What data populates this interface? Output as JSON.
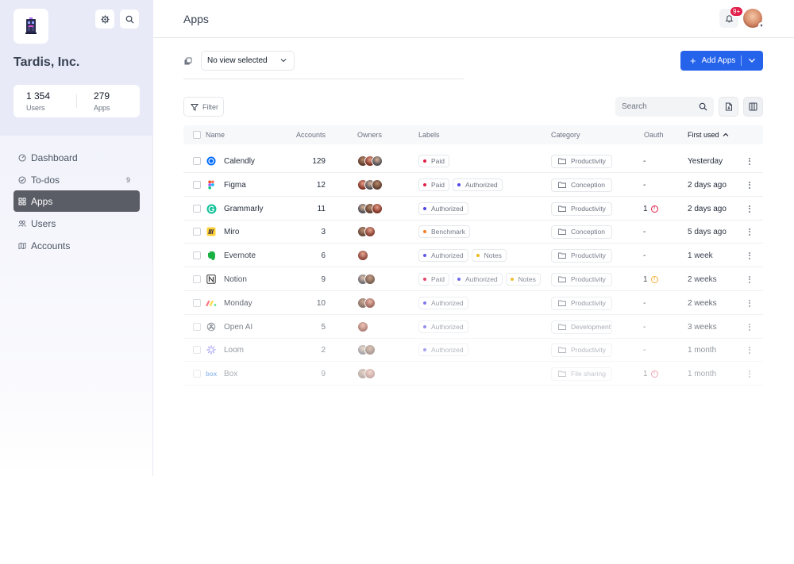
{
  "org": {
    "name": "Tardis, Inc.",
    "users_count": "1 354",
    "users_label": "Users",
    "apps_count": "279",
    "apps_label": "Apps"
  },
  "nav": [
    {
      "label": "Dashboard",
      "icon": "dashboard-icon",
      "badge": ""
    },
    {
      "label": "To-dos",
      "icon": "todos-icon",
      "badge": "9"
    },
    {
      "label": "Apps",
      "icon": "apps-grid-icon",
      "badge": ""
    },
    {
      "label": "Users",
      "icon": "users-icon",
      "badge": ""
    },
    {
      "label": "Accounts",
      "icon": "accounts-map-icon",
      "badge": ""
    }
  ],
  "header": {
    "title": "Apps",
    "notifications": "9+"
  },
  "toolbar": {
    "view_label": "No view selected",
    "add_label": "Add Apps",
    "filter_label": "Filter",
    "search_placeholder": "Search"
  },
  "columns": {
    "name": "Name",
    "accounts": "Accounts",
    "owners": "Owners",
    "labels": "Labels",
    "category": "Category",
    "oauth": "Oauth",
    "first_used": "First used"
  },
  "colors": {
    "accent": "#2563eb",
    "paid": "#e11d48",
    "authorized": "#4f46e5",
    "benchmark": "#f97316",
    "notes": "#eab308",
    "warn_red": "#e11d48",
    "warn_orange": "#f59e0b"
  },
  "rows": [
    {
      "name": "Calendly",
      "icon": "calendly-icon",
      "accounts": "129",
      "owners": 3,
      "labels": [
        {
          "text": "Paid",
          "color": "#e11d48"
        }
      ],
      "category": "Productivity",
      "oauth": "-",
      "oauth_warn": "",
      "first_used": "Yesterday",
      "opacity": 1
    },
    {
      "name": "Figma",
      "icon": "figma-icon",
      "accounts": "12",
      "owners": 3,
      "labels": [
        {
          "text": "Paid",
          "color": "#e11d48"
        },
        {
          "text": "Authorized",
          "color": "#4f46e5"
        }
      ],
      "category": "Conception",
      "oauth": "-",
      "oauth_warn": "",
      "first_used": "2 days ago",
      "opacity": 1
    },
    {
      "name": "Grammarly",
      "icon": "grammarly-icon",
      "accounts": "11",
      "owners": 3,
      "labels": [
        {
          "text": "Authorized",
          "color": "#4f46e5"
        }
      ],
      "category": "Productivity",
      "oauth": "1",
      "oauth_warn": "red",
      "first_used": "2 days ago",
      "opacity": 1
    },
    {
      "name": "Miro",
      "icon": "miro-icon",
      "accounts": "3",
      "owners": 2,
      "labels": [
        {
          "text": "Benchmark",
          "color": "#f97316"
        }
      ],
      "category": "Conception",
      "oauth": "-",
      "oauth_warn": "",
      "first_used": "5 days ago",
      "opacity": 0.95
    },
    {
      "name": "Evernote",
      "icon": "evernote-icon",
      "accounts": "6",
      "owners": 1,
      "labels": [
        {
          "text": "Authorized",
          "color": "#4f46e5"
        },
        {
          "text": "Notes",
          "color": "#eab308"
        }
      ],
      "category": "Productivity",
      "oauth": "-",
      "oauth_warn": "",
      "first_used": "1 week",
      "opacity": 0.9
    },
    {
      "name": "Notion",
      "icon": "notion-icon",
      "accounts": "9",
      "owners": 2,
      "labels": [
        {
          "text": "Paid",
          "color": "#e11d48"
        },
        {
          "text": "Authorized",
          "color": "#4f46e5"
        },
        {
          "text": "Notes",
          "color": "#eab308"
        }
      ],
      "category": "Productivity",
      "oauth": "1",
      "oauth_warn": "orange",
      "first_used": "2 weeks",
      "opacity": 0.82
    },
    {
      "name": "Monday",
      "icon": "monday-icon",
      "accounts": "10",
      "owners": 2,
      "labels": [
        {
          "text": "Authorized",
          "color": "#4f46e5"
        }
      ],
      "category": "Productivity",
      "oauth": "-",
      "oauth_warn": "",
      "first_used": "2 weeks",
      "opacity": 0.72
    },
    {
      "name": "Open AI",
      "icon": "openai-icon",
      "accounts": "5",
      "owners": 1,
      "labels": [
        {
          "text": "Authorized",
          "color": "#4f46e5"
        }
      ],
      "category": "Development",
      "oauth": "-",
      "oauth_warn": "",
      "first_used": "3 weeks",
      "opacity": 0.6
    },
    {
      "name": "Loom",
      "icon": "loom-icon",
      "accounts": "2",
      "owners": 2,
      "labels": [
        {
          "text": "Authorized",
          "color": "#4f46e5"
        }
      ],
      "category": "Productivity",
      "oauth": "-",
      "oauth_warn": "",
      "first_used": "1 month",
      "opacity": 0.5
    },
    {
      "name": "Box",
      "icon": "box-icon",
      "accounts": "9",
      "owners": 2,
      "labels": [],
      "category": "File sharing",
      "oauth": "1",
      "oauth_warn": "red",
      "first_used": "1 month",
      "opacity": 0.4
    }
  ]
}
